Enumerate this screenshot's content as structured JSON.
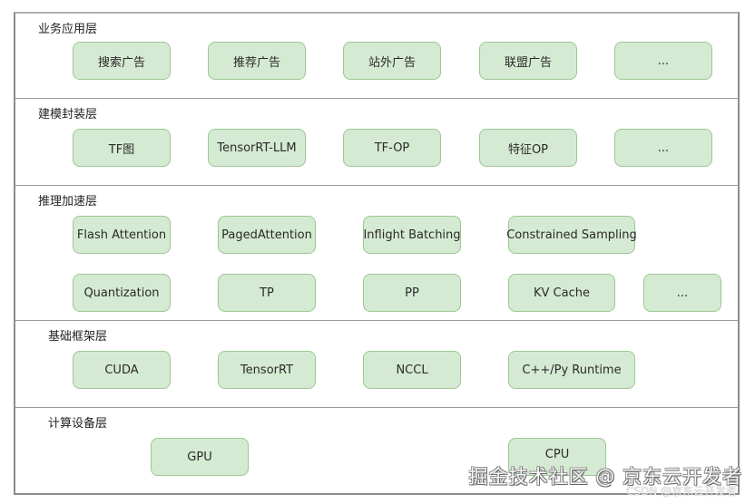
{
  "diagram": {
    "layers": [
      {
        "title": "业务应用层",
        "rows": [
          [
            "搜索广告",
            "推荐广告",
            "站外广告",
            "联盟广告",
            "..."
          ]
        ]
      },
      {
        "title": "建模封装层",
        "rows": [
          [
            "TF图",
            "TensorRT-LLM",
            "TF-OP",
            "特征OP",
            "..."
          ]
        ]
      },
      {
        "title": "推理加速层",
        "rows": [
          [
            "Flash Attention",
            "PagedAttention",
            "Inflight Batching",
            "Constrained Sampling"
          ],
          [
            "Quantization",
            "TP",
            "PP",
            "KV Cache",
            "..."
          ]
        ]
      },
      {
        "title": "基础框架层",
        "rows": [
          [
            "CUDA",
            "TensorRT",
            "NCCL",
            "C++/Py Runtime"
          ]
        ]
      },
      {
        "title": "计算设备层",
        "rows": [
          [
            "GPU",
            "CPU"
          ]
        ]
      }
    ],
    "colors": {
      "box_fill": "#d5ead2",
      "box_border": "#9cc793",
      "frame": "#8c8c8c"
    }
  },
  "watermark": {
    "main": "掘金技术社区 @ 京东云开发者",
    "secondary": "CSDN @京东云开发者"
  }
}
